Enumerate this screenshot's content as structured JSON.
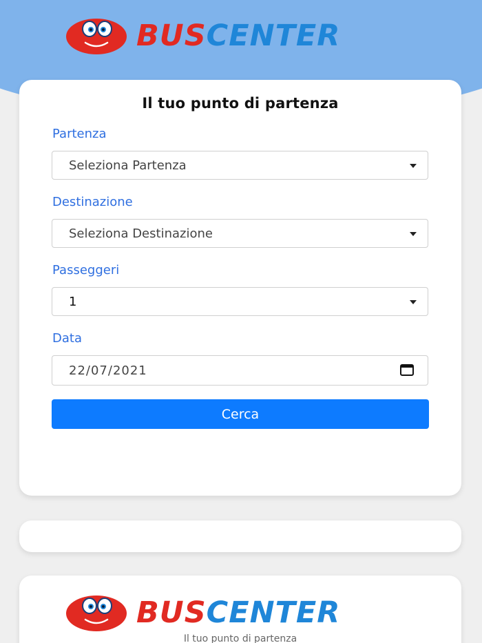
{
  "brand": {
    "name_part1": "BUS",
    "name_part2": "CENTER",
    "tagline": "Il tuo punto di partenza"
  },
  "search_form": {
    "title": "Il tuo punto di partenza",
    "departure": {
      "label": "Partenza",
      "value": "Seleziona Partenza"
    },
    "destination": {
      "label": "Destinazione",
      "value": "Seleziona Destinazione"
    },
    "passengers": {
      "label": "Passeggeri",
      "value": "1"
    },
    "date": {
      "label": "Data",
      "value": "22/07/2021"
    },
    "submit_label": "Cerca"
  },
  "colors": {
    "header_bg": "#7fb3eb",
    "brand_red": "#e12a22",
    "brand_blue": "#1f86d8",
    "label_blue": "#2f6fe0",
    "button_blue": "#0d7bff",
    "page_bg": "#efefef"
  },
  "icons": {
    "logo_mascot": "smiley-bus-icon",
    "select_caret": "chevron-down-icon",
    "date_picker": "calendar-icon"
  }
}
